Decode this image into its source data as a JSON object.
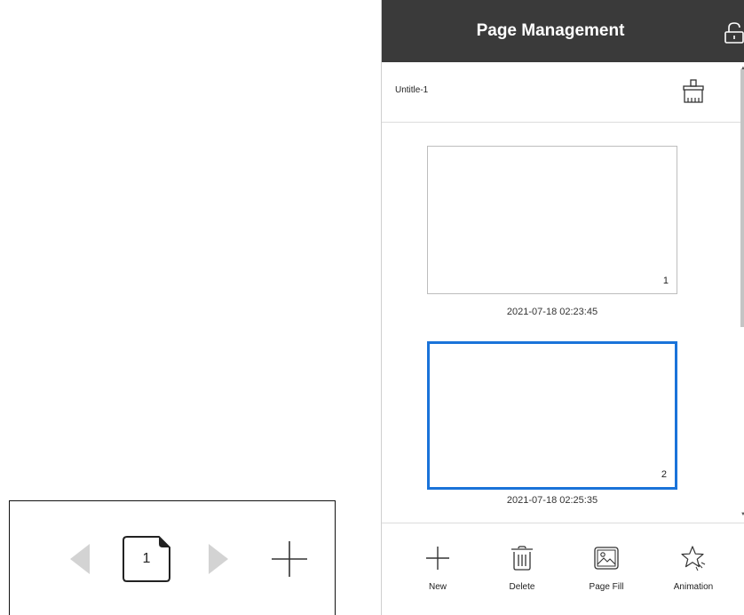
{
  "navigator": {
    "current_page": "1"
  },
  "panel": {
    "title": "Page Management",
    "document_name": "Untitle-1",
    "pages": [
      {
        "number": "1",
        "timestamp": "2021-07-18 02:23:45",
        "selected": false
      },
      {
        "number": "2",
        "timestamp": "2021-07-18 02:25:35",
        "selected": true
      }
    ],
    "selection_color": "#1a73d9",
    "header_color": "#3a3a3a"
  },
  "toolbar": {
    "new_label": "New",
    "delete_label": "Delete",
    "fill_label": "Page Fill",
    "animation_label": "Animation"
  },
  "icons": {
    "lock": "unlock-icon",
    "clear": "broom-icon",
    "new": "plus-icon",
    "delete": "trash-icon",
    "fill": "image-icon",
    "animation": "star-icon"
  }
}
